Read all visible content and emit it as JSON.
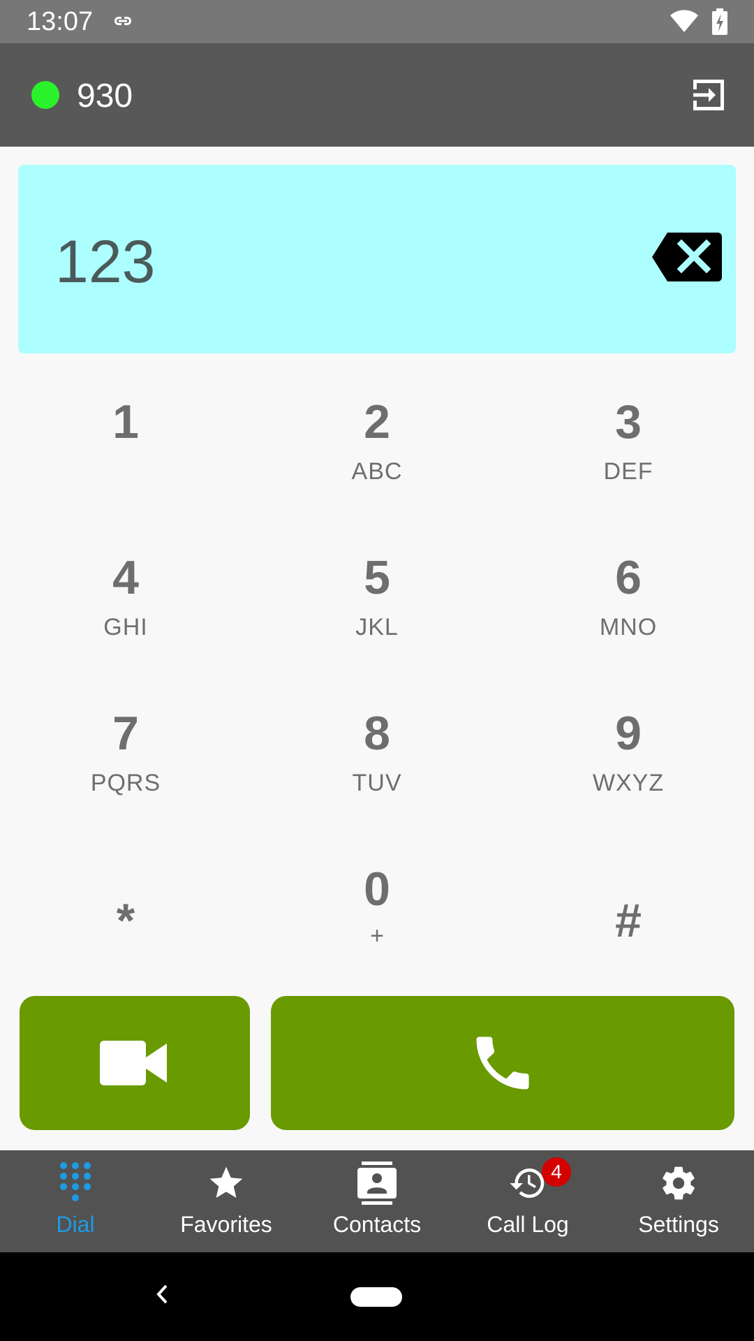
{
  "status_bar": {
    "time": "13:07",
    "icons": [
      "link-icon",
      "wifi-icon",
      "battery-charging-icon"
    ]
  },
  "app_bar": {
    "account": "930",
    "presence_color": "#2af22a",
    "logout_icon": "logout-icon"
  },
  "dial_input": {
    "value": "123",
    "background": "#adfefe",
    "backspace_icon": "backspace-icon"
  },
  "keypad": {
    "keys": [
      {
        "digit": "1",
        "letters": ""
      },
      {
        "digit": "2",
        "letters": "ABC"
      },
      {
        "digit": "3",
        "letters": "DEF"
      },
      {
        "digit": "4",
        "letters": "GHI"
      },
      {
        "digit": "5",
        "letters": "JKL"
      },
      {
        "digit": "6",
        "letters": "MNO"
      },
      {
        "digit": "7",
        "letters": "PQRS"
      },
      {
        "digit": "8",
        "letters": "TUV"
      },
      {
        "digit": "9",
        "letters": "WXYZ"
      },
      {
        "digit": "*",
        "letters": ""
      },
      {
        "digit": "0",
        "letters": "+"
      },
      {
        "digit": "#",
        "letters": ""
      }
    ]
  },
  "actions": {
    "video_icon": "video-camera-icon",
    "call_icon": "phone-icon",
    "color": "#699a00"
  },
  "bottom_nav": {
    "items": [
      {
        "label": "Dial",
        "icon": "dialpad-icon",
        "active": true
      },
      {
        "label": "Favorites",
        "icon": "star-icon"
      },
      {
        "label": "Contacts",
        "icon": "contacts-icon"
      },
      {
        "label": "Call Log",
        "icon": "history-icon",
        "badge": "4"
      },
      {
        "label": "Settings",
        "icon": "gear-icon"
      }
    ],
    "active_color": "#1e9be6"
  },
  "system_nav": {
    "icons": [
      "back-icon",
      "home-icon"
    ]
  }
}
